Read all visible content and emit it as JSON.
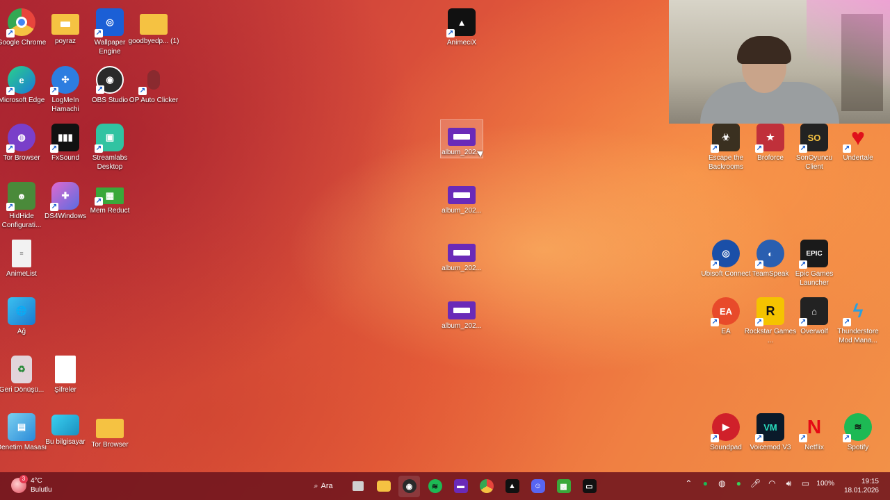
{
  "desktop": {
    "icons_left": [
      {
        "label": "Google Chrome",
        "icon": "chrome-icon",
        "color": "#e8453c"
      },
      {
        "label": "poyraz",
        "icon": "folder-icon",
        "color": "#f5c242"
      },
      {
        "label": "Wallpaper Engine",
        "icon": "wallpaper-engine-icon",
        "color": "#1b5fd6"
      },
      {
        "label": "goodbyedp... (1)",
        "icon": "folder-icon",
        "color": "#f5c242"
      },
      {
        "label": "Microsoft Edge",
        "icon": "edge-icon",
        "color": "#1aa88a"
      },
      {
        "label": "LogMeIn Hamachi",
        "icon": "hamachi-icon",
        "color": "#2d7de0"
      },
      {
        "label": "OBS Studio",
        "icon": "obs-icon",
        "color": "#2a2a2a"
      },
      {
        "label": "OP Auto Clicker",
        "icon": "mouse-icon",
        "color": "#8a2a2f"
      },
      {
        "label": "Tor Browser",
        "icon": "tor-icon",
        "color": "#7a3fc9"
      },
      {
        "label": "FxSound",
        "icon": "fxsound-icon",
        "color": "#111111"
      },
      {
        "label": "Streamlabs Desktop",
        "icon": "streamlabs-icon",
        "color": "#31c3a2"
      },
      {
        "label": "HidHide Configurati...",
        "icon": "hidhide-icon",
        "color": "#4a8a3a"
      },
      {
        "label": "DS4Windows",
        "icon": "gamepad-icon",
        "color": "#7c5cd6"
      },
      {
        "label": "Mem Reduct",
        "icon": "memory-icon",
        "color": "#3aa83a"
      },
      {
        "label": "AnimeList",
        "icon": "text-file-icon",
        "color": "#f2f2f2"
      },
      {
        "label": "Ağ",
        "icon": "network-icon",
        "color": "#2aa0d8"
      },
      {
        "label": "Geri Dönüşü...",
        "icon": "recycle-bin-icon",
        "color": "#d8e8f0"
      },
      {
        "label": "Şifreler",
        "icon": "document-icon",
        "color": "#ffffff"
      },
      {
        "label": "Denetim Masası",
        "icon": "control-panel-icon",
        "color": "#3a9ad8"
      },
      {
        "label": "Bu bilgisayar",
        "icon": "computer-icon",
        "color": "#1fb8d8"
      },
      {
        "label": "Tor Browser",
        "icon": "folder-icon",
        "color": "#f5c242"
      }
    ],
    "icons_middle": [
      {
        "label": "AnimeciX",
        "icon": "animecix-icon",
        "color": "#111111"
      },
      {
        "label": "album_202...",
        "icon": "album-icon",
        "color": "#6a2ab8"
      },
      {
        "label": "album_202...",
        "icon": "album-icon",
        "color": "#6a2ab8"
      },
      {
        "label": "album_202...",
        "icon": "album-icon",
        "color": "#6a2ab8"
      },
      {
        "label": "album_202...",
        "icon": "album-icon",
        "color": "#6a2ab8"
      }
    ],
    "icons_right": [
      {
        "label": "Escape the Backrooms",
        "icon": "game-icon",
        "color": "#3a3020"
      },
      {
        "label": "Broforce",
        "icon": "broforce-icon",
        "color": "#c0303a"
      },
      {
        "label": "SonOyuncu Client",
        "icon": "sonoyuncu-icon",
        "color": "#222222"
      },
      {
        "label": "Undertale",
        "icon": "heart-icon",
        "color": "#e0101a"
      },
      {
        "label": "Ubisoft Connect",
        "icon": "ubisoft-icon",
        "color": "#1a4fa8"
      },
      {
        "label": "TeamSpeak",
        "icon": "teamspeak-icon",
        "color": "#2a5fb0"
      },
      {
        "label": "Epic Games Launcher",
        "icon": "epic-icon",
        "color": "#1a1a1a"
      },
      {
        "label": "EA",
        "icon": "ea-icon",
        "color": "#e84a2a"
      },
      {
        "label": "Rockstar Games ...",
        "icon": "rockstar-icon",
        "color": "#f5c300"
      },
      {
        "label": "Overwolf",
        "icon": "overwolf-icon",
        "color": "#222222"
      },
      {
        "label": "Thunderstore Mod Mana...",
        "icon": "thunderstore-icon",
        "color": "#2aa0e0"
      },
      {
        "label": "Soundpad",
        "icon": "soundpad-icon",
        "color": "#d0202a"
      },
      {
        "label": "Voicemod V3",
        "icon": "voicemod-icon",
        "color": "#0a1a2a"
      },
      {
        "label": "Netflix",
        "icon": "netflix-icon",
        "color": "#e50914"
      },
      {
        "label": "Spotify",
        "icon": "spotify-icon",
        "color": "#1db954"
      }
    ]
  },
  "taskbar": {
    "weather": {
      "temp": "4°C",
      "condition": "Bulutlu",
      "badge": "3"
    },
    "search_label": "Ara",
    "apps": [
      {
        "name": "start-button",
        "color": "#2b8cf0"
      },
      {
        "name": "task-view",
        "color": "#d0d0d0"
      },
      {
        "name": "file-explorer",
        "color": "#f5c242"
      },
      {
        "name": "obs",
        "color": "#2a2a2a"
      },
      {
        "name": "spotify",
        "color": "#1db954"
      },
      {
        "name": "clapper",
        "color": "#6a2ab8"
      },
      {
        "name": "chrome",
        "color": "#e8453c"
      },
      {
        "name": "animecix",
        "color": "#111111"
      },
      {
        "name": "discord",
        "color": "#5865f2"
      },
      {
        "name": "minecraft",
        "color": "#3aa83a"
      },
      {
        "name": "terminal",
        "color": "#111111"
      }
    ],
    "battery": "100%",
    "time": "19:15",
    "date": "18.01.2026"
  }
}
